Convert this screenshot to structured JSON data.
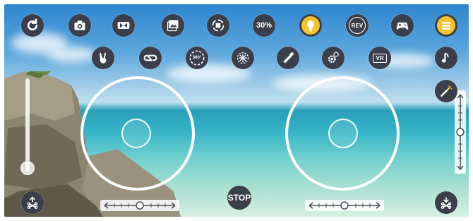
{
  "top_row": [
    {
      "name": "refresh-button",
      "icon": "refresh-icon",
      "label": ""
    },
    {
      "name": "camera-button",
      "icon": "camera-icon",
      "label": ""
    },
    {
      "name": "video-button",
      "icon": "video-icon",
      "label": ""
    },
    {
      "name": "gallery-button",
      "icon": "gallery-icon",
      "label": ""
    },
    {
      "name": "rotate-screen-button",
      "icon": "rotate-screen-icon",
      "label": ""
    },
    {
      "name": "speed-button",
      "icon": "",
      "label": "30%"
    },
    {
      "name": "light-button",
      "icon": "lightbulb-icon",
      "label": ""
    },
    {
      "name": "reverse-button",
      "icon": "",
      "label": "REV"
    },
    {
      "name": "gamepad-button",
      "icon": "gamepad-icon",
      "label": ""
    },
    {
      "name": "menu-button",
      "icon": "list-icon",
      "label": ""
    }
  ],
  "second_row": [
    {
      "name": "gesture-button",
      "icon": "peace-hand-icon",
      "label": ""
    },
    {
      "name": "loop-button",
      "icon": "loop-icon",
      "label": ""
    },
    {
      "name": "flip-360-button",
      "icon": "",
      "label": "360°"
    },
    {
      "name": "headless-button",
      "icon": "compass-icon",
      "label": ""
    },
    {
      "name": "calibrate-button",
      "icon": "level-icon",
      "label": ""
    },
    {
      "name": "settings-button",
      "icon": "gear-icon",
      "label": ""
    },
    {
      "name": "vr-button",
      "icon": "",
      "label": "VR"
    }
  ],
  "right_column": [
    {
      "name": "music-button",
      "icon": "music-note-icon",
      "label": ""
    },
    {
      "name": "magic-button",
      "icon": "magic-wand-icon",
      "label": ""
    }
  ],
  "stop": {
    "label": "STOP"
  },
  "colors": {
    "button_bg": "#3a3f4b",
    "accent_yellow": "#f2c230"
  }
}
